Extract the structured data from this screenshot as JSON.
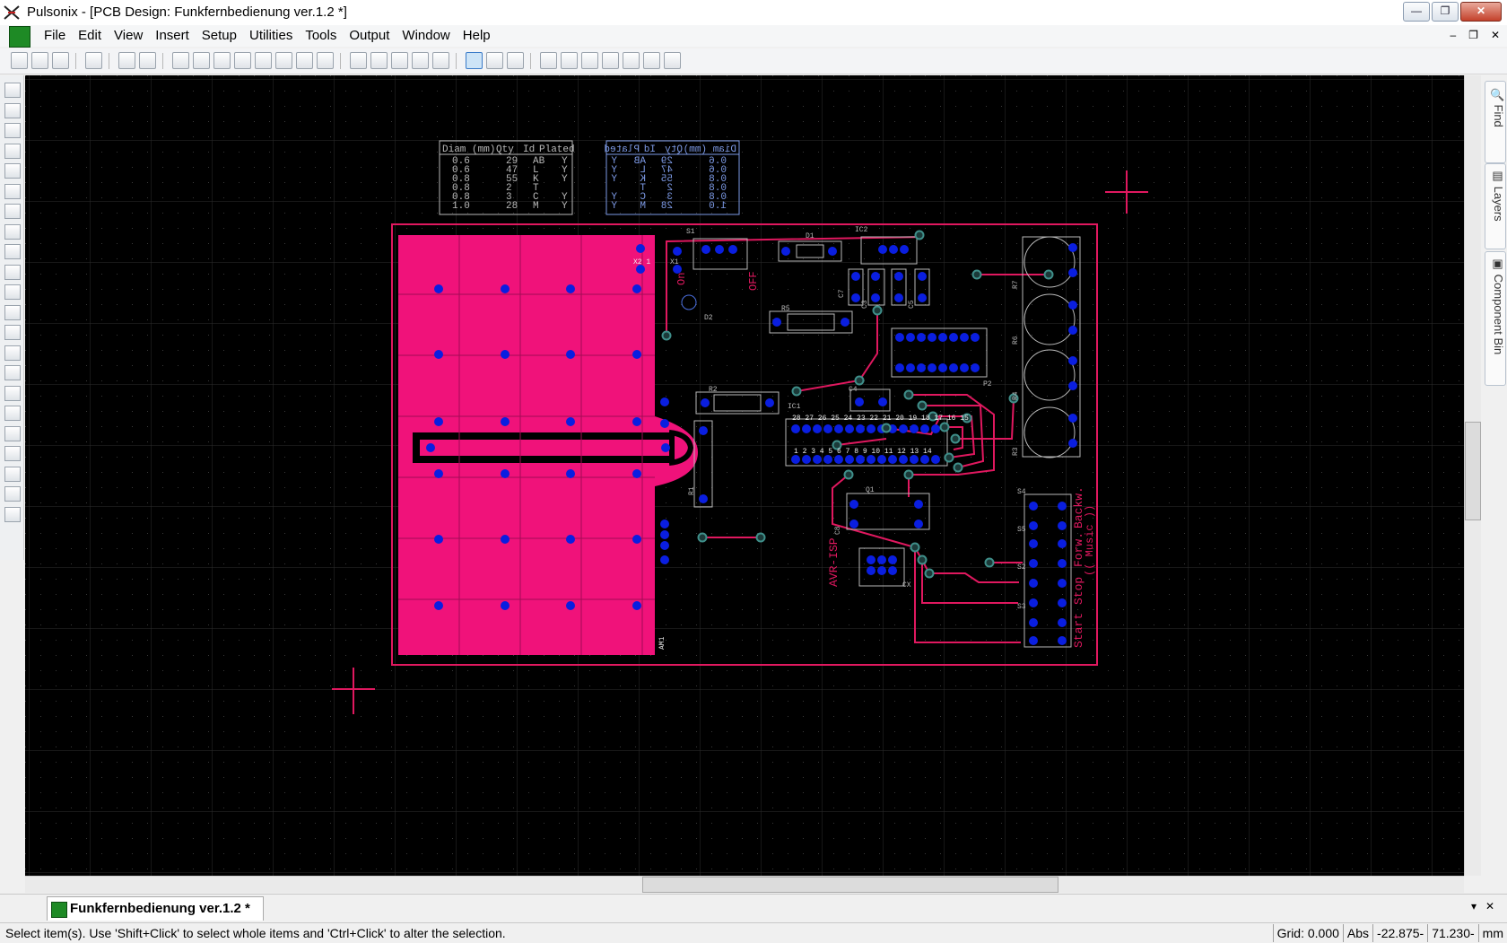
{
  "window": {
    "title": "Pulsonix - [PCB Design: Funkfernbedienung ver.1.2 *]",
    "min_label": "—",
    "max_label": "❐",
    "close_label": "✕"
  },
  "menu": {
    "items": [
      "File",
      "Edit",
      "View",
      "Insert",
      "Setup",
      "Utilities",
      "Tools",
      "Output",
      "Window",
      "Help"
    ],
    "mdi_min": "‒",
    "mdi_restore": "❐",
    "mdi_close": "✕"
  },
  "toolbar": {
    "icons": [
      "new-icon",
      "open-icon",
      "save-icon",
      "print-icon",
      "undo-icon",
      "redo-icon",
      "copy-icon",
      "book-icon",
      "component-icon",
      "route-icon",
      "design-icon",
      "measure-icon",
      "settings-icon",
      "report-icon",
      "zoom-all-icon",
      "zoom-window-icon",
      "zoom-prev-icon",
      "zoom-in-icon",
      "zoom-out-icon",
      "select-icon",
      "select-item-icon",
      "select-multi-icon",
      "dimension-icon",
      "table-icon",
      "layers-icon",
      "swap-icon",
      "highlight-icon",
      "lock-icon",
      "unlock-icon"
    ]
  },
  "left_toolbar": {
    "icons": [
      "select-tool-icon",
      "board-icon",
      "area-icon",
      "cutout-icon",
      "keepout-icon",
      "copper-icon",
      "template-icon",
      "pour-icon",
      "track-icon",
      "corner-icon",
      "arc-icon",
      "via-icon",
      "text-icon",
      "testpoint-icon",
      "dimension-tool-icon",
      "label-icon",
      "route-tool-icon",
      "autoroute-icon",
      "move-icon",
      "rotate-icon",
      "mirror-icon",
      "drc-icon"
    ]
  },
  "right_panel": {
    "tabs": [
      "Find",
      "Layers",
      "Component Bin"
    ]
  },
  "pcb": {
    "drill_table": {
      "headers": [
        "Diam (mm)",
        "Qty",
        "Id",
        "Plated"
      ],
      "rows": [
        [
          "0.6",
          "29",
          "AB",
          "Y"
        ],
        [
          "0.6",
          "47",
          "L",
          "Y"
        ],
        [
          "0.8",
          "55",
          "K",
          "Y"
        ],
        [
          "0.8",
          "2",
          "T",
          ""
        ],
        [
          "0.8",
          "3",
          "C",
          "Y"
        ],
        [
          "1.0",
          "28",
          "M",
          "Y"
        ]
      ]
    },
    "labels": {
      "on": "On",
      "off": "OFF",
      "avr_isp": "AVR-ISP",
      "start": "Start",
      "stop": "Stop",
      "forw": "Forw.",
      "backw": "Backw.",
      "music": "(( Music ))",
      "s1": "S1",
      "d1": "D1",
      "ic2": "IC2",
      "x1": "X1",
      "x2": "X2 1",
      "d2": "D2",
      "r5": "R5",
      "r2": "R2",
      "r1": "R1",
      "ic1": "IC1",
      "q1": "Q1",
      "r7": "R7",
      "r6": "R6",
      "r4": "R4",
      "r3": "R3",
      "s4": "S4",
      "s5": "S5",
      "s2": "S2",
      "s3": "S3",
      "am1": "AM1",
      "c7": "C7",
      "c3": "C3",
      "c5": "C5",
      "c4": "C4",
      "c8": "C8",
      "p2": "P2",
      "cx": "CX",
      "ic1_top": "28 27 26 25 24 23 22 21 20 19 18 17 16 15",
      "ic1_bottom": "1  2  3  4  5  6  7  8  9  10 11 12 13 14"
    },
    "colors": {
      "background": "#000000",
      "copper": "#f0127a",
      "board_outline": "#e0185f",
      "pad": "#0a1ee0",
      "via_ring": "#3f8f8a",
      "silk": "#b9b9b9",
      "drill_table_right": "#7d9ae6"
    }
  },
  "tabs": {
    "document": "Funkfernbedienung ver.1.2 *",
    "close": "✕",
    "pin": "▾"
  },
  "status": {
    "message": "Select item(s). Use 'Shift+Click' to select whole items and 'Ctrl+Click' to alter the selection.",
    "grid": "Grid: 0.000",
    "mode": "Abs",
    "x": "-22.875-",
    "y": "71.230-",
    "units": "mm"
  }
}
